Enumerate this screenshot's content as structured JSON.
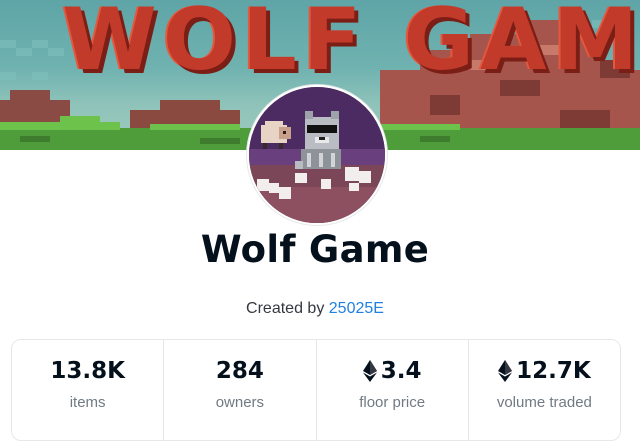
{
  "banner": {
    "title": "WOLF GAME"
  },
  "collection": {
    "name": "Wolf Game",
    "created_by_prefix": "Created by",
    "creator": "25025E"
  },
  "stats": [
    {
      "value": "13.8K",
      "label": "items",
      "icon": ""
    },
    {
      "value": "284",
      "label": "owners",
      "icon": ""
    },
    {
      "value": "3.4",
      "label": "floor price",
      "icon": "ethereum-icon"
    },
    {
      "value": "12.7K",
      "label": "volume traded",
      "icon": "ethereum-icon"
    }
  ],
  "colors": {
    "accent_link": "#2081e2",
    "title_red": "#c23a2a",
    "text_dark": "#04111d",
    "text_muted": "#707a83"
  }
}
